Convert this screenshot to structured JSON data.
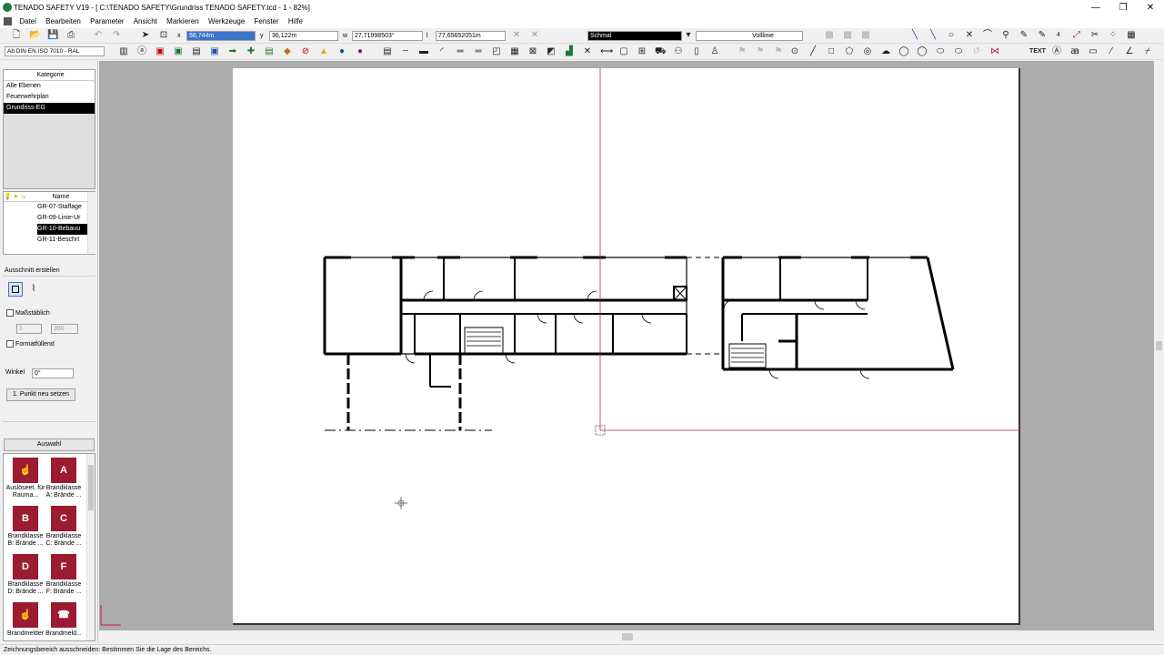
{
  "window": {
    "title": "TENADO SAFETY V19 - [ C:\\TENADO SAFETY\\Grundriss TENADO SAFETY.tcd - 1 - 82%]",
    "minimize": "—",
    "restore": "❐",
    "close": "✕"
  },
  "menu": [
    "Datei",
    "Bearbeiten",
    "Parameter",
    "Ansicht",
    "Markieren",
    "Werkzeuge",
    "Fenster",
    "Hilfe"
  ],
  "toolbar": {
    "x_label": "x",
    "x_value": "58,744m",
    "y_label": "y",
    "y_value": "36,122m",
    "w_label": "w",
    "w_value": "27,71998503°",
    "l_label": "l",
    "l_value": "77,65652051m",
    "line_width": "Schmal",
    "line_type": "Volllinie",
    "layer_standard": "Ab DIN EN ISO 7010 - RAL",
    "text_tool": "TEXT",
    "four": "4"
  },
  "category_panel": {
    "header": "Kategorie",
    "items": [
      "Alle Ebenen",
      "Feuerwehrplan",
      "Grundriss-EG"
    ],
    "selected": 2
  },
  "layers_panel": {
    "header": "Name",
    "items": [
      "GR-07-Staffage",
      "GR-09-Linie-Ur",
      "GR-10-Bebauu",
      "GR-11-Beschrt"
    ],
    "selected": 2
  },
  "cut_panel": {
    "title": "Ausschnitt erstellen",
    "scale_label": "Maßstäblich",
    "scale_a": "1",
    "scale_b": "350",
    "fill_label": "Formatfüllend",
    "angle_label": "Winkel",
    "angle_value": "0°",
    "reset_button": "1. Punkt neu setzen"
  },
  "selection_panel": {
    "header": "Auswahl",
    "symbols": [
      {
        "icon": "fire-trigger-icon",
        "glyph": "☝",
        "label": "Auslöseet. für Rauma..."
      },
      {
        "icon": "fire-class-a-icon",
        "glyph": "A",
        "label": "Brandklasse A: Brände ..."
      },
      {
        "icon": "fire-class-b-icon",
        "glyph": "B",
        "label": "Brandklasse B: Brände ..."
      },
      {
        "icon": "fire-class-c-icon",
        "glyph": "C",
        "label": "Brandklasse C: Brände ..."
      },
      {
        "icon": "fire-class-d-icon",
        "glyph": "D",
        "label": "Brandklasse D: Brände ..."
      },
      {
        "icon": "fire-class-f-icon",
        "glyph": "F",
        "label": "Brandklasse F: Brände ..."
      },
      {
        "icon": "fire-alarm-icon",
        "glyph": "☝",
        "label": "Brandmelder"
      },
      {
        "icon": "fire-phone-icon",
        "glyph": "☎",
        "label": "Brandmeld..."
      }
    ]
  },
  "status": {
    "text": "Zeichnungsbereich ausschneiden: Bestimmen Sie die Lage des Bereichs."
  },
  "colors": {
    "accent": "#c2185b",
    "symbol_red": "#9b1b30",
    "canvas_bg": "#ababab"
  }
}
